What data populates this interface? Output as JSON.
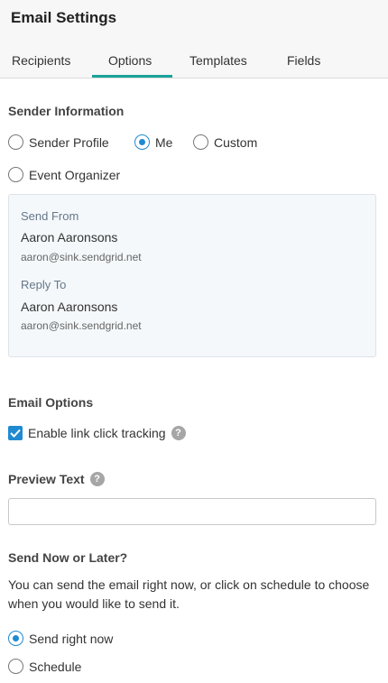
{
  "header": {
    "title": "Email Settings",
    "tabs": [
      "Recipients",
      "Options",
      "Templates",
      "Fields"
    ],
    "active_tab": "Options"
  },
  "sender_info": {
    "title": "Sender Information",
    "options": [
      "Sender Profile",
      "Me",
      "Custom",
      "Event Organizer"
    ],
    "selected": "Me",
    "send_from_label": "Send From",
    "send_from_name": "Aaron Aaronsons",
    "send_from_email": "aaron@sink.sendgrid.net",
    "reply_to_label": "Reply To",
    "reply_to_name": "Aaron Aaronsons",
    "reply_to_email": "aaron@sink.sendgrid.net"
  },
  "email_options": {
    "title": "Email Options",
    "link_tracking_label": "Enable link click tracking",
    "link_tracking_checked": true
  },
  "preview_text": {
    "title": "Preview Text",
    "value": ""
  },
  "send_timing": {
    "title": "Send Now or Later?",
    "description": "You can send the email right now, or click on schedule to choose when you would like to send it.",
    "options": [
      "Send right now",
      "Schedule"
    ],
    "selected": "Send right now"
  },
  "colors": {
    "accent": "#1f8ad0",
    "tab_underline": "#1aa39a",
    "box_background": "#f4f8fb"
  },
  "icons": {
    "help": "question-circle-icon",
    "check": "checkmark-icon"
  }
}
